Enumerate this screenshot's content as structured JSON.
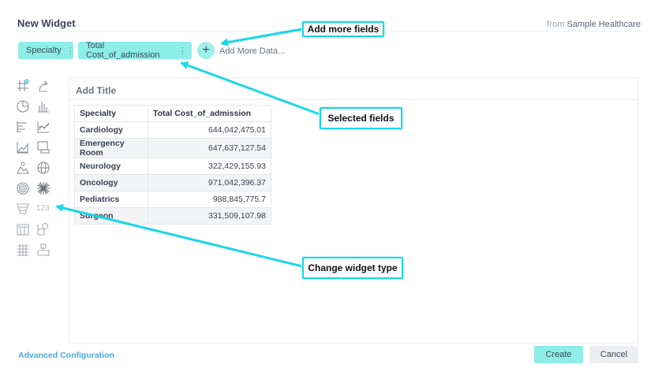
{
  "header": {
    "title": "New Widget",
    "source_prefix": "from",
    "source_name": "Sample Healthcare"
  },
  "fields": {
    "chips": [
      {
        "label": "Specialty",
        "menu": "⋮"
      },
      {
        "label": "Total Cost_of_admission",
        "menu": "⋮"
      }
    ],
    "add_symbol": "+",
    "add_label": "Add More Data..."
  },
  "widget_types": [
    "table-icon",
    "pivot-icon",
    "pie-icon",
    "column-icon",
    "bar-icon",
    "line-icon",
    "area-icon",
    "indicator-icon",
    "scatter-map-icon",
    "area-map-icon",
    "polar-icon",
    "sunburst-icon",
    "funnel-icon",
    "number-icon",
    "calendar-heatmap-icon",
    "treemap-icon",
    "table-with-bars-icon",
    "scatter-icon"
  ],
  "number_icon_text": "123",
  "panel": {
    "title": "Add Title",
    "table": {
      "columns": [
        "Specialty",
        "Total Cost_of_admission"
      ],
      "rows": [
        [
          "Cardiology",
          "644,042,475.01"
        ],
        [
          "Emergency Room",
          "647,637,127.54"
        ],
        [
          "Neurology",
          "322,429,155.93"
        ],
        [
          "Oncology",
          "971,042,396.37"
        ],
        [
          "Pediatrics",
          "988,845,775.7"
        ],
        [
          "Surgeon",
          "331,509,107.98"
        ]
      ]
    }
  },
  "footer": {
    "advanced": "Advanced Configuration",
    "create": "Create",
    "cancel": "Cancel"
  },
  "annotations": {
    "add_more": "Add more fields",
    "selected": "Selected fields",
    "change_type": "Change widget type",
    "color": "#19d7e6"
  }
}
